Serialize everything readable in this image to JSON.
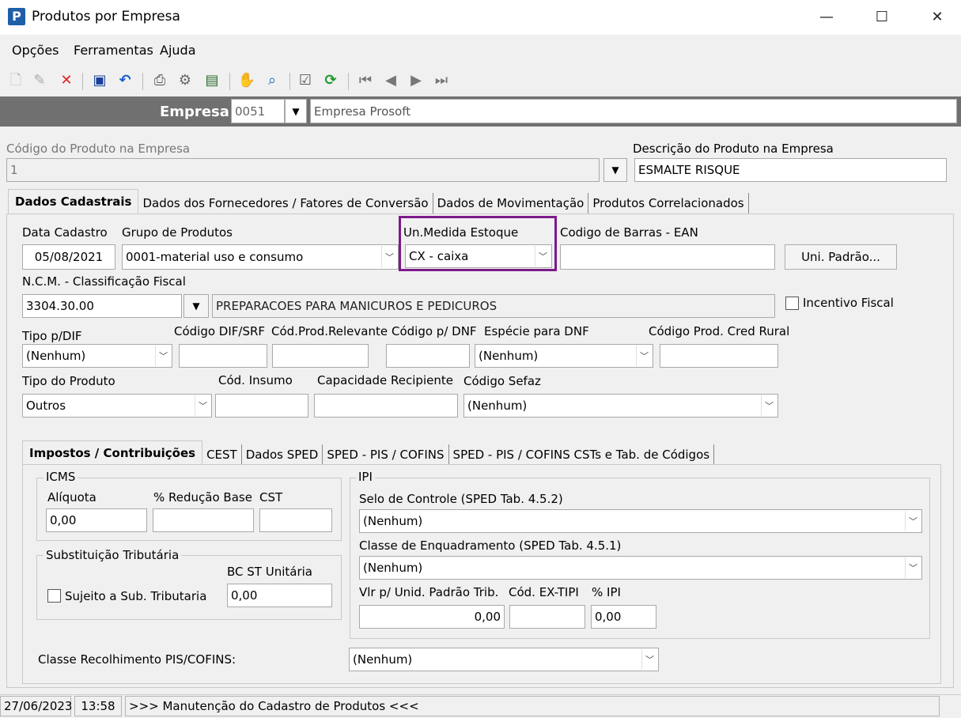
{
  "window": {
    "title": "Produtos por Empresa",
    "minimize": "—",
    "maximize": "☐",
    "close": "✕"
  },
  "menu": [
    "Opções",
    "Ferramentas",
    "Ajuda"
  ],
  "empresa": {
    "label": "Empresa",
    "code": "0051",
    "name": "Empresa Prosoft"
  },
  "produto": {
    "codigo_label": "Código do Produto na Empresa",
    "codigo_value": "1",
    "descricao_label": "Descrição do Produto na Empresa",
    "descricao_value": "ESMALTE RISQUE"
  },
  "main_tabs": [
    "Dados Cadastrais",
    "Dados dos Fornecedores / Fatores de Conversão",
    "Dados de Movimentação",
    "Produtos Correlacionados"
  ],
  "cadastro": {
    "data_label": "Data Cadastro",
    "data_value": "05/08/2021",
    "grupo_label": "Grupo de Produtos",
    "grupo_value": "0001-material uso e consumo",
    "unmed_label": "Un.Medida Estoque",
    "unmed_value": "CX - caixa",
    "ean_label": "Codigo de Barras - EAN",
    "ean_value": "",
    "uni_padrao_button": "Uni. Padrão...",
    "ncm_label": "N.C.M. -  Classificação Fiscal",
    "ncm_value": "3304.30.00",
    "ncm_desc": "PREPARACOES PARA MANICUROS E PEDICUROS",
    "incentivo_label": "Incentivo Fiscal",
    "tipo_dif_label": "Tipo p/DIF",
    "tipo_dif_value": "(Nenhum)",
    "cod_dif_label": "Código DIF/SRF",
    "cod_prod_rel_label": "Cód.Prod.Relevante",
    "cod_dnf_label": "Código p/ DNF",
    "especie_dnf_label": "Espécie para DNF",
    "especie_dnf_value": "(Nenhum)",
    "cod_cred_rural_label": "Código Prod. Cred Rural",
    "tipo_produto_label": "Tipo do Produto",
    "tipo_produto_value": "Outros",
    "cod_insumo_label": "Cód. Insumo",
    "capacidade_label": "Capacidade Recipiente",
    "cod_sefaz_label": "Código Sefaz",
    "cod_sefaz_value": "(Nenhum)"
  },
  "sub_tabs": [
    "Impostos / Contribuições",
    "CEST",
    "Dados SPED",
    "SPED - PIS / COFINS",
    "SPED - PIS / COFINS CSTs e Tab. de Códigos"
  ],
  "icms": {
    "title": "ICMS",
    "aliquota_label": "Alíquota",
    "aliquota_value": "0,00",
    "reducao_label": "% Redução Base",
    "cst_label": "CST"
  },
  "st": {
    "title": "Substituição Tributária",
    "sujeito_label": "Sujeito a Sub. Tributaria",
    "bc_label": "BC ST Unitária",
    "bc_value": "0,00"
  },
  "ipi": {
    "title": "IPI",
    "selo_label": "Selo de Controle (SPED Tab. 4.5.2)",
    "selo_value": "(Nenhum)",
    "classe_label": "Classe de Enquadramento (SPED Tab. 4.5.1)",
    "classe_value": "(Nenhum)",
    "vlr_label": "Vlr p/ Unid. Padrão Trib.",
    "vlr_value": "0,00",
    "ex_tipi_label": "Cód. EX-TIPI",
    "pct_label": "% IPI",
    "pct_value": "0,00"
  },
  "classe_pis": {
    "label": "Classe Recolhimento PIS/COFINS:",
    "value": "(Nenhum)"
  },
  "status": {
    "date": "27/06/2023",
    "time": "13:58",
    "message": ">>> Manutenção do Cadastro de Produtos <<<"
  },
  "icons": [
    "new-icon",
    "edit-icon",
    "delete-icon",
    "save-icon",
    "undo-icon",
    "print-icon",
    "print-setup-icon",
    "export-icon",
    "hand-icon",
    "search-icon",
    "properties-icon",
    "refresh-icon",
    "first-icon",
    "prev-icon",
    "next-icon",
    "last-icon"
  ]
}
